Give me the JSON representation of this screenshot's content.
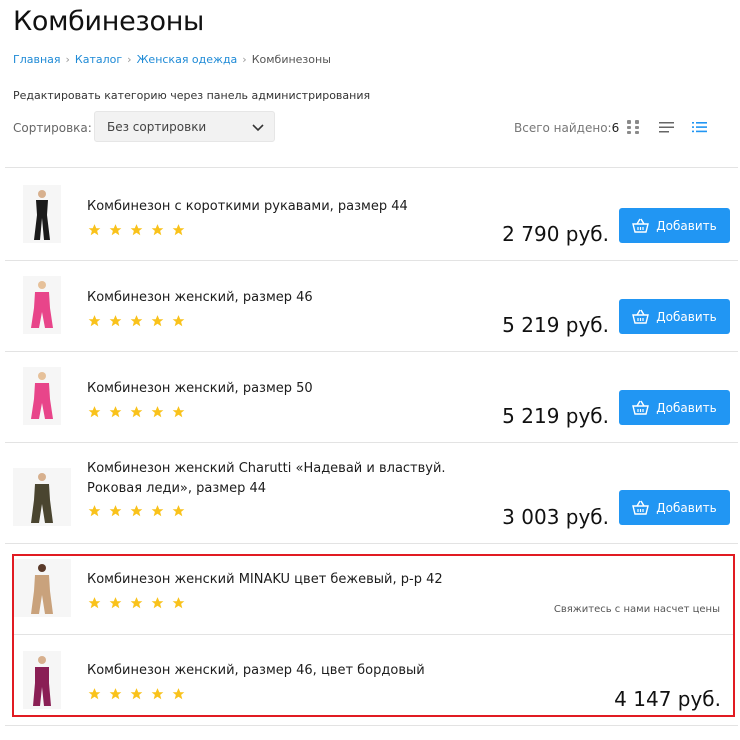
{
  "page": {
    "title": "Комбинезоны",
    "breadcrumb": [
      "Главная",
      "Каталог",
      "Женская одежда",
      "Комбинезоны"
    ],
    "admin_note": "Редактировать категорию через панель администрирования"
  },
  "sort": {
    "label": "Сортировка:",
    "value": "Без сортировки"
  },
  "found": {
    "label": "Всего найдено:",
    "count": "6"
  },
  "view_icons": [
    "grid-view-icon",
    "list-view-icon",
    "compact-list-view-icon"
  ],
  "colors": {
    "accent": "#2196f3",
    "star": "#f9c21b",
    "highlight": "#e11b22",
    "link": "#1e8ad6"
  },
  "products": [
    {
      "name": "Комбинезон с короткими рукавами, размер 44",
      "price": "2 790 руб.",
      "button": "Добавить",
      "rating": 5,
      "image_color": "#1a1a1a"
    },
    {
      "name": "Комбинезон женский, размер 46",
      "price": "5 219 руб.",
      "button": "Добавить",
      "rating": 5,
      "image_color": "#e8458a"
    },
    {
      "name": "Комбинезон женский, размер 50",
      "price": "5 219 руб.",
      "button": "Добавить",
      "rating": 5,
      "image_color": "#e8458a"
    },
    {
      "name": "Комбинезон женский Charutti «Надевай и властвуй. Роковая леди», размер 44",
      "price": "3 003 руб.",
      "button": "Добавить",
      "rating": 5,
      "image_color": "#4a4530"
    },
    {
      "name": "Комбинезон женский MINAKU цвет бежевый, р-р 42",
      "contact": "Свяжитесь с нами насчет цены",
      "rating": 5,
      "image_color": "#c9a27c"
    },
    {
      "name": "Комбинезон женский, размер 46, цвет бордовый",
      "price": "4 147 руб.",
      "rating": 5,
      "image_color": "#8a1f55"
    }
  ]
}
